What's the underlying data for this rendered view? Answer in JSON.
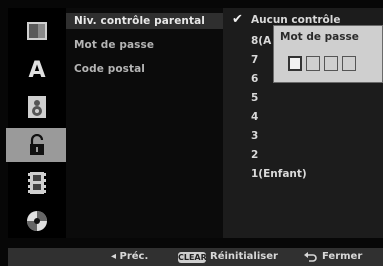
{
  "menu": {
    "items": [
      {
        "label": "Niv. contrôle parental",
        "selected": true
      },
      {
        "label": "Mot de passe",
        "selected": false
      },
      {
        "label": "Code postal",
        "selected": false
      }
    ]
  },
  "levels": {
    "items": [
      "Aucun contrôle",
      "8(A",
      "7",
      "6",
      "5",
      "4",
      "3",
      "2",
      "1(Enfant)"
    ],
    "checked_index": 0
  },
  "popup": {
    "title": "Mot de passe",
    "digits": 4
  },
  "bottom_bar": {
    "prev_label": "◂ Préc.",
    "clear_badge": "CLEAR",
    "reset_label": "Réinitialiser",
    "close_label": "Fermer"
  },
  "sidebar_icons": [
    "disc-menu-icon",
    "language-icon",
    "audio-speaker-icon",
    "lock-icon",
    "film-icon",
    "disc-icon"
  ],
  "colors": {
    "selected_row": "#2f2f2f",
    "active_icon_bg": "#9a9a9a",
    "popup_bg": "#cfcfcf"
  }
}
